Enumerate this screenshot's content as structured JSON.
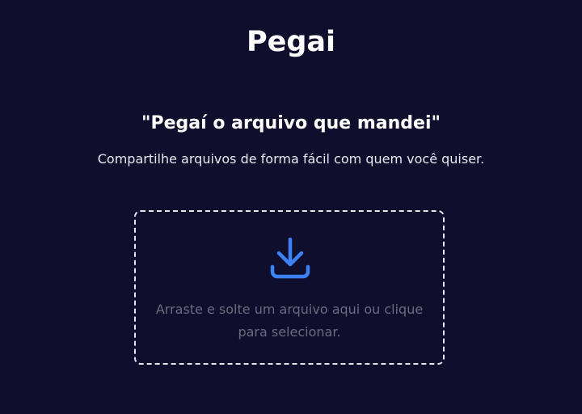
{
  "app": {
    "title": "Pegai"
  },
  "hero": {
    "tagline": "\"Pegaí o arquivo que mandei\"",
    "subtitle": "Compartilhe arquivos de forma fácil com quem você quiser."
  },
  "dropzone": {
    "icon": "download-icon",
    "instruction_line1": "Arraste e solte um arquivo aqui ou clique",
    "instruction_line2": "para selecionar.",
    "accent_color": "#3b82f6",
    "border_color": "#e6e6ee"
  },
  "colors": {
    "background": "#0f0f2d",
    "text": "#ffffff",
    "muted_text": "#6b6b80"
  }
}
